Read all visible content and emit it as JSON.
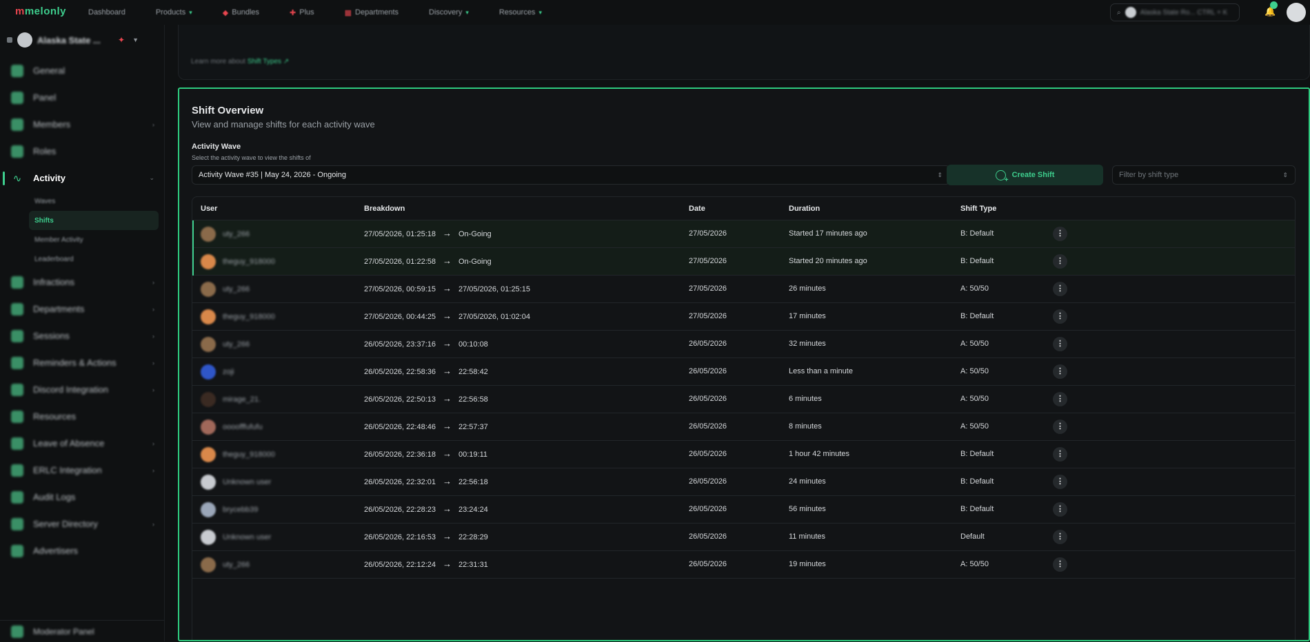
{
  "topbar": {
    "logo": "melonly",
    "nav": [
      {
        "label": "Dashboard",
        "chevron": false,
        "icon": ""
      },
      {
        "label": "Products",
        "chevron": true,
        "icon": ""
      },
      {
        "label": "Bundles",
        "chevron": false,
        "icon": "tag-icon"
      },
      {
        "label": "Plus",
        "chevron": false,
        "icon": "plus-icon"
      },
      {
        "label": "Departments",
        "chevron": false,
        "icon": "building-icon"
      },
      {
        "label": "Discovery",
        "chevron": true,
        "icon": ""
      },
      {
        "label": "Resources",
        "chevron": true,
        "icon": ""
      }
    ],
    "search_text": "Alaska State Ro... CTRL + K"
  },
  "sidebar": {
    "server_name": "Alaska State ...",
    "items": [
      {
        "label": "General",
        "chevron": false
      },
      {
        "label": "Panel",
        "chevron": false
      },
      {
        "label": "Members",
        "chevron": true
      },
      {
        "label": "Roles",
        "chevron": false
      },
      {
        "label": "Activity",
        "chevron": true,
        "active": true
      },
      {
        "label": "Infractions",
        "chevron": true
      },
      {
        "label": "Departments",
        "chevron": true
      },
      {
        "label": "Sessions",
        "chevron": true
      },
      {
        "label": "Reminders & Actions",
        "chevron": true
      },
      {
        "label": "Discord Integration",
        "chevron": true
      },
      {
        "label": "Resources",
        "chevron": false
      },
      {
        "label": "Leave of Absence",
        "chevron": true
      },
      {
        "label": "ERLC Integration",
        "chevron": true
      },
      {
        "label": "Audit Logs",
        "chevron": false
      },
      {
        "label": "Server Directory",
        "chevron": true
      },
      {
        "label": "Advertisers",
        "chevron": false
      }
    ],
    "activity_sub": [
      "Waves",
      "Shifts",
      "Member Activity",
      "Leaderboard"
    ],
    "moderator_panel": "Moderator Panel"
  },
  "upper_card": {
    "learn_prefix": "Learn more about ",
    "learn_link": "Shift Types"
  },
  "shift_overview": {
    "title": "Shift Overview",
    "subtitle": "View and manage shifts for each activity wave",
    "wave_label": "Activity Wave",
    "wave_help": "Select the activity wave to view the shifts of",
    "wave_selected": "Activity Wave #35 | May 24, 2026 - Ongoing",
    "create_label": "Create Shift",
    "filter_placeholder": "Filter by shift type",
    "columns": {
      "user": "User",
      "breakdown": "Breakdown",
      "date": "Date",
      "duration": "Duration",
      "type": "Shift Type"
    },
    "rows": [
      {
        "user": "uty_266",
        "start": "27/05/2026, 01:25:18",
        "end": "On-Going",
        "date": "27/05/2026",
        "duration": "Started 17 minutes ago",
        "type": "B: Default",
        "ongoing": true,
        "avatar": "#8a6a4a"
      },
      {
        "user": "theguy_918000",
        "start": "27/05/2026, 01:22:58",
        "end": "On-Going",
        "date": "27/05/2026",
        "duration": "Started 20 minutes ago",
        "type": "B: Default",
        "ongoing": true,
        "avatar": "#d9884a"
      },
      {
        "user": "uty_266",
        "start": "27/05/2026, 00:59:15",
        "end": "27/05/2026, 01:25:15",
        "date": "27/05/2026",
        "duration": "26 minutes",
        "type": "A: 50/50",
        "ongoing": false,
        "avatar": "#8a6a4a"
      },
      {
        "user": "theguy_918000",
        "start": "27/05/2026, 00:44:25",
        "end": "27/05/2026, 01:02:04",
        "date": "27/05/2026",
        "duration": "17 minutes",
        "type": "B: Default",
        "ongoing": false,
        "avatar": "#d9884a"
      },
      {
        "user": "uty_266",
        "start": "26/05/2026, 23:37:16",
        "end": "00:10:08",
        "date": "26/05/2026",
        "duration": "32 minutes",
        "type": "A: 50/50",
        "ongoing": false,
        "avatar": "#8a6a4a"
      },
      {
        "user": "zoji",
        "start": "26/05/2026, 22:58:36",
        "end": "22:58:42",
        "date": "26/05/2026",
        "duration": "Less than a minute",
        "type": "A: 50/50",
        "ongoing": false,
        "avatar": "#2f56c8"
      },
      {
        "user": "mirage_21.",
        "start": "26/05/2026, 22:50:13",
        "end": "22:56:58",
        "date": "26/05/2026",
        "duration": "6 minutes",
        "type": "A: 50/50",
        "ongoing": false,
        "avatar": "#3a2a22"
      },
      {
        "user": "oooofffufufu",
        "start": "26/05/2026, 22:48:46",
        "end": "22:57:37",
        "date": "26/05/2026",
        "duration": "8 minutes",
        "type": "A: 50/50",
        "ongoing": false,
        "avatar": "#a0685a"
      },
      {
        "user": "theguy_918000",
        "start": "26/05/2026, 22:36:18",
        "end": "00:19:11",
        "date": "26/05/2026",
        "duration": "1 hour 42 minutes",
        "type": "B: Default",
        "ongoing": false,
        "avatar": "#d9884a"
      },
      {
        "user": "Unknown user",
        "start": "26/05/2026, 22:32:01",
        "end": "22:56:18",
        "date": "26/05/2026",
        "duration": "24 minutes",
        "type": "B: Default",
        "ongoing": false,
        "avatar": "#c8cbd0"
      },
      {
        "user": "brycebb39",
        "start": "26/05/2026, 22:28:23",
        "end": "23:24:24",
        "date": "26/05/2026",
        "duration": "56 minutes",
        "type": "B: Default",
        "ongoing": false,
        "avatar": "#9aa6b8"
      },
      {
        "user": "Unknown user",
        "start": "26/05/2026, 22:16:53",
        "end": "22:28:29",
        "date": "26/05/2026",
        "duration": "11 minutes",
        "type": "Default",
        "ongoing": false,
        "avatar": "#c8cbd0"
      },
      {
        "user": "uty_266",
        "start": "26/05/2026, 22:12:24",
        "end": "22:31:31",
        "date": "26/05/2026",
        "duration": "19 minutes",
        "type": "A: 50/50",
        "ongoing": false,
        "avatar": "#8a6a4a"
      }
    ]
  }
}
